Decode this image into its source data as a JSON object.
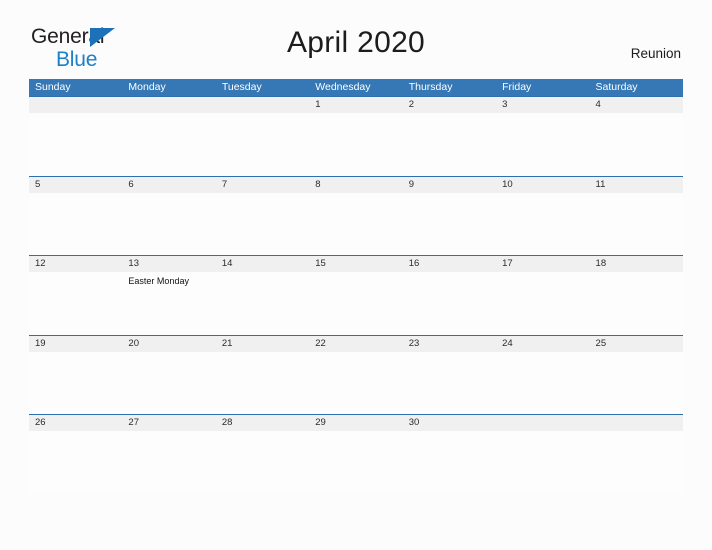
{
  "branding": {
    "logo_text_primary": "General",
    "logo_text_secondary": "Blue",
    "logo_primary_color": "#231f20",
    "logo_secondary_color": "#1b81c8",
    "logo_triangle_color": "#1d71b8"
  },
  "header": {
    "title": "April 2020",
    "locale": "Reunion"
  },
  "theme": {
    "header_bar_color": "#3578b5",
    "rule_color": "#2f6fae",
    "date_band_color": "#f0f0f0",
    "page_background": "#fcfcfd"
  },
  "calendar": {
    "month": "April",
    "year": "2020",
    "weekday_headers": [
      "Sunday",
      "Monday",
      "Tuesday",
      "Wednesday",
      "Thursday",
      "Friday",
      "Saturday"
    ],
    "weeks": [
      {
        "days": [
          {
            "date": "",
            "event": ""
          },
          {
            "date": "",
            "event": ""
          },
          {
            "date": "",
            "event": ""
          },
          {
            "date": "1",
            "event": ""
          },
          {
            "date": "2",
            "event": ""
          },
          {
            "date": "3",
            "event": ""
          },
          {
            "date": "4",
            "event": ""
          }
        ]
      },
      {
        "days": [
          {
            "date": "5",
            "event": ""
          },
          {
            "date": "6",
            "event": ""
          },
          {
            "date": "7",
            "event": ""
          },
          {
            "date": "8",
            "event": ""
          },
          {
            "date": "9",
            "event": ""
          },
          {
            "date": "10",
            "event": ""
          },
          {
            "date": "11",
            "event": ""
          }
        ]
      },
      {
        "days": [
          {
            "date": "12",
            "event": ""
          },
          {
            "date": "13",
            "event": "Easter Monday"
          },
          {
            "date": "14",
            "event": ""
          },
          {
            "date": "15",
            "event": ""
          },
          {
            "date": "16",
            "event": ""
          },
          {
            "date": "17",
            "event": ""
          },
          {
            "date": "18",
            "event": ""
          }
        ]
      },
      {
        "days": [
          {
            "date": "19",
            "event": ""
          },
          {
            "date": "20",
            "event": ""
          },
          {
            "date": "21",
            "event": ""
          },
          {
            "date": "22",
            "event": ""
          },
          {
            "date": "23",
            "event": ""
          },
          {
            "date": "24",
            "event": ""
          },
          {
            "date": "25",
            "event": ""
          }
        ]
      },
      {
        "days": [
          {
            "date": "26",
            "event": ""
          },
          {
            "date": "27",
            "event": ""
          },
          {
            "date": "28",
            "event": ""
          },
          {
            "date": "29",
            "event": ""
          },
          {
            "date": "30",
            "event": ""
          },
          {
            "date": "",
            "event": ""
          },
          {
            "date": "",
            "event": ""
          }
        ]
      }
    ]
  }
}
